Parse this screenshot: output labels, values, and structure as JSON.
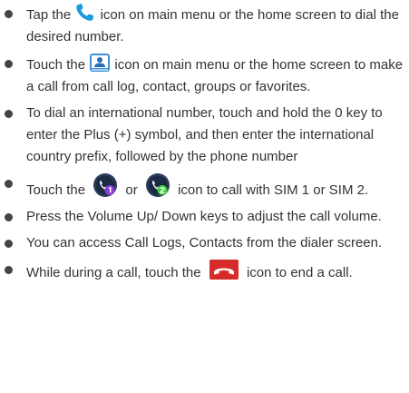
{
  "bullets": [
    {
      "before": "Tap the",
      "icon": "phone-dial-icon",
      "after": "icon on main menu or the home screen to dial the desired number."
    },
    {
      "before": "Touch the",
      "icon": "contacts-call-log-icon",
      "after": "icon on main menu or the home screen to make a call from call log, contact, groups or favorites."
    },
    {
      "text": "To dial an international number, touch and hold the 0 key to enter the Plus (+) symbol, and then enter the international country prefix, followed by the phone number"
    },
    {
      "before": "Touch the",
      "icon": "sim1-call-icon",
      "middle": "or",
      "icon2": "sim2-call-icon",
      "after": "icon to call with SIM 1 or SIM 2."
    },
    {
      "text": "Press the Volume Up/ Down keys to adjust the call volume."
    },
    {
      "text": "You can access Call Logs, Contacts from the dialer screen."
    },
    {
      "before": "While during a call, touch the",
      "icon": "end-call-icon",
      "after": "icon to end a call."
    }
  ],
  "colors": {
    "text": "#333333",
    "bullet": "#444444",
    "phone_icon": "#1a9be0",
    "sim1_accent": "#8b3fd9",
    "sim2_accent": "#3fcf3f",
    "end_call": "#d62b2b"
  }
}
